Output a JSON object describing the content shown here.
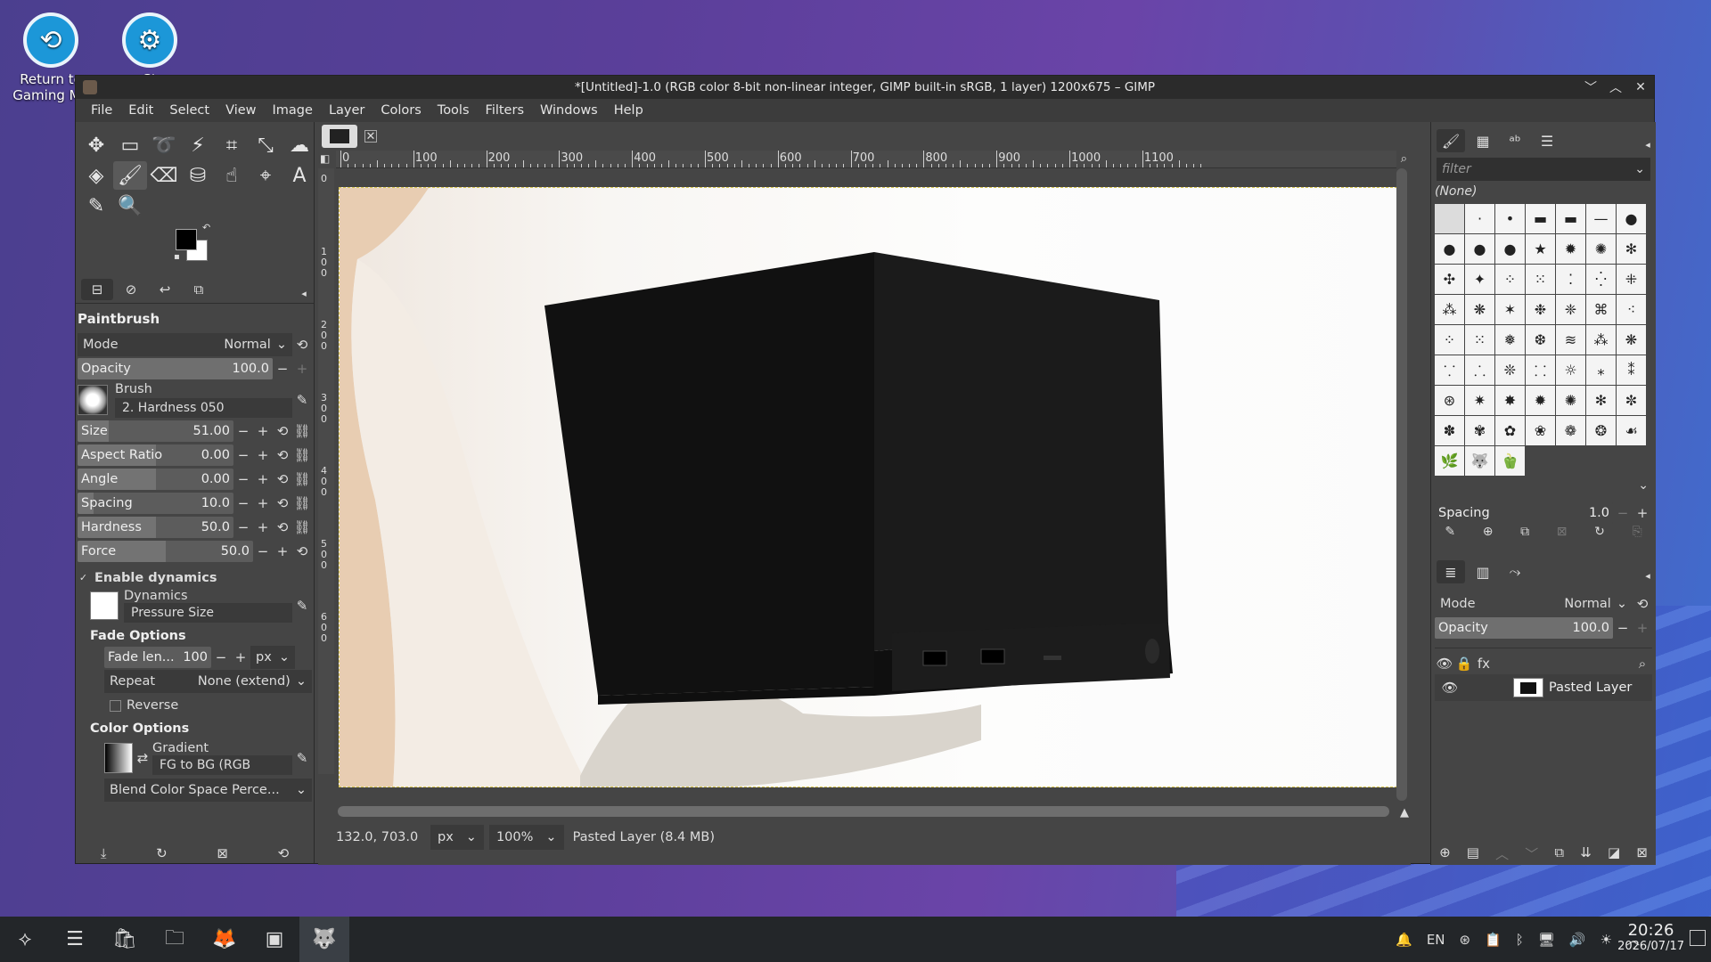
{
  "desktop": {
    "icons": [
      {
        "label": "Return to Gaming Mode",
        "label_visible": "Return to\nGaming Mo"
      },
      {
        "label": "Steam",
        "label_visible": "St"
      }
    ]
  },
  "window": {
    "title": "*[Untitled]-1.0 (RGB color 8-bit non-linear integer, GIMP built-in sRGB, 1 layer) 1200x675 – GIMP",
    "menu": [
      "File",
      "Edit",
      "Select",
      "View",
      "Image",
      "Layer",
      "Colors",
      "Tools",
      "Filters",
      "Windows",
      "Help"
    ]
  },
  "tool_options": {
    "tool_name": "Paintbrush",
    "mode_label": "Mode",
    "mode_value": "Normal",
    "opacity_label": "Opacity",
    "opacity_value": "100.0",
    "brush_label": "Brush",
    "brush_value": "2. Hardness 050",
    "params": [
      {
        "label": "Size",
        "value": "51.00",
        "fill": 0.2
      },
      {
        "label": "Aspect Ratio",
        "value": "0.00",
        "fill": 0.5
      },
      {
        "label": "Angle",
        "value": "0.00",
        "fill": 0.5
      },
      {
        "label": "Spacing",
        "value": "10.0",
        "fill": 0.1
      },
      {
        "label": "Hardness",
        "value": "50.0",
        "fill": 0.5
      },
      {
        "label": "Force",
        "value": "50.0",
        "fill": 0.5
      }
    ],
    "enable_dynamics": "Enable dynamics",
    "dynamics_label": "Dynamics",
    "dynamics_value": "Pressure Size",
    "fade_options": "Fade Options",
    "fade_length_label": "Fade len...",
    "fade_length_value": "100",
    "fade_unit": "px",
    "repeat_label": "Repeat",
    "repeat_value": "None (extend)",
    "reverse_label": "Reverse",
    "color_options": "Color Options",
    "gradient_label": "Gradient",
    "gradient_value": "FG to BG (RGB",
    "blend_space": "Blend Color Space Perce..."
  },
  "rulers": {
    "h_labels": [
      "0",
      "100",
      "200",
      "300",
      "400",
      "500",
      "600",
      "700",
      "800",
      "900",
      "1000",
      "1100"
    ],
    "v_labels": [
      "0",
      "100",
      "200",
      "300",
      "400",
      "500",
      "600"
    ]
  },
  "status": {
    "coords": "132.0, 703.0",
    "unit": "px",
    "zoom": "100%",
    "layer_info": "Pasted Layer (8.4 MB)"
  },
  "brushes_panel": {
    "filter_placeholder": "filter",
    "selected": "(None)",
    "spacing_label": "Spacing",
    "spacing_value": "1.0"
  },
  "layers_panel": {
    "mode_label": "Mode",
    "mode_value": "Normal",
    "opacity_label": "Opacity",
    "opacity_value": "100.0",
    "layers": [
      {
        "name": "Pasted Layer",
        "visible": true
      }
    ]
  },
  "taskbar": {
    "tray_lang": "EN",
    "time": "20:26",
    "date": "2026/07/17"
  }
}
